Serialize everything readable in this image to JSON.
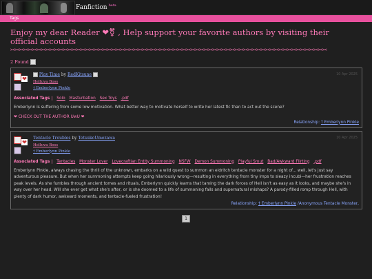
{
  "header": {
    "brand": "Fanfiction",
    "brand_sup": "beta",
    "tags_link": "Tags"
  },
  "headline": "Enjoy my dear Reader ❤⚧ , Help support your favorite authors by visiting their official accounts",
  "divider": "><><><><><><><><><><><><><><><><><><><><><><><><><><><><><><><><><><><><><><><><><><><><><><><><><><><><><><><><><><><><><><><><><><><><><><><><",
  "found_text": "2 Found",
  "stories": [
    {
      "title": "Play Time",
      "by": "by",
      "author": "RedKitsune",
      "date": "10 Apr 2025",
      "fandom": "Helluva Boss",
      "relationship_tag": "† Emberlynn Pinkle",
      "tags_label": "Associated Tags |",
      "tags": [
        "Solo",
        "Masturbation",
        "Sex Toys",
        ".pdf"
      ],
      "summary": "Emberlynn is suffering from some low motivation. What better way to motivate herself to write her latest fic than to act out the scene?",
      "cta": "❤ CHECK OUT THE AUTHOR UwU ❤",
      "relationship_label": "Relationship:",
      "relationship": "† Emberlynn Pinkle",
      "relationship_rest": ""
    },
    {
      "title": "Tentacle Troubles",
      "by": "by",
      "author": "TetsukoUmezawa",
      "date": "10 Apr 2025",
      "fandom": "Helluva Boss",
      "relationship_tag": "† Emberlynn Pinkle",
      "tags_label": "Associated Tags |",
      "tags": [
        "Tentacles",
        "Monster Lover",
        "Lovecraftian Entity Summoning",
        "NSFW",
        "Demon Summoning",
        "Playful Smut",
        "Bad/Awkward Flirting",
        ".pdf"
      ],
      "summary": "Emberlynn Pinkle, always chasing the thrill of the unknown, embarks on a wild quest to summon an eldritch tentacle monster for a night of... well, let's just say adventurous pleasure. But when her summoning attempts keep going hilariously wrong—resulting in everything from tiny imps to sleazy incubi—her frustration reaches peak levels. As she fumbles through ancient tomes and rituals, Emberlynn quickly learns that taming the dark forces of Hell isn't as easy as it looks, and maybe she's in way over her head. Will she ever get what she's after, or is she doomed to a life of summoning fails and supernatural mishaps? A parody-filled romp through Hell, with plenty of dark humor, awkward moments, and tentacle-fueled frustration!",
      "cta": "",
      "relationship_label": "Relationship:",
      "relationship": "† Emberlynn Pinkle",
      "relationship_rest": "/Anonymous Tentacle Monster,"
    }
  ],
  "pager": {
    "current": "1"
  }
}
